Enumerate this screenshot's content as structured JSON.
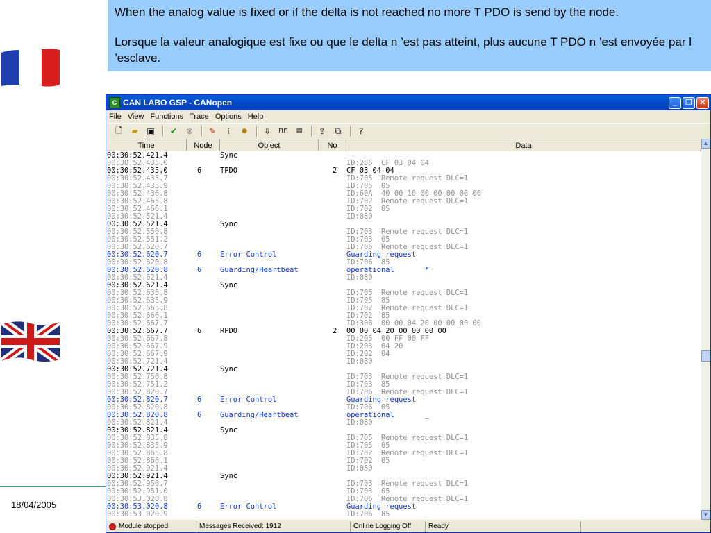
{
  "slide": {
    "caption_en": "When the analog value is fixed or if the delta is not reached no more T PDO is send by the node.",
    "caption_fr": "Lorsque la valeur analogique est fixe ou que le delta n ’est pas atteint, plus aucune T PDO n ’est envoyée par l ’esclave.",
    "date": "18/04/2005"
  },
  "window": {
    "title": "CAN LABO GSP - CANopen",
    "menu": [
      "File",
      "View",
      "Functions",
      "Trace",
      "Options",
      "Help"
    ],
    "columns": [
      "Time",
      "Node",
      "Object",
      "No",
      "Data"
    ]
  },
  "log": [
    {
      "time": "00:30:52.421.4",
      "node": "",
      "object": "Sync",
      "no": "",
      "data": "",
      "style": "black"
    },
    {
      "time": "00:30:52.435.0",
      "node": "",
      "object": "",
      "no": "",
      "data": "ID:286  CF 03 04 04",
      "style": "gray"
    },
    {
      "time": "00:30:52.435.0",
      "node": "6",
      "object": "TPDO",
      "no": "2",
      "data": "CF 03 04 04",
      "style": "black"
    },
    {
      "time": "00:30:52.435.7",
      "node": "",
      "object": "",
      "no": "",
      "data": "ID:705  Remote request DLC=1",
      "style": "gray"
    },
    {
      "time": "00:30:52.435.9",
      "node": "",
      "object": "",
      "no": "",
      "data": "ID:705  05",
      "style": "gray"
    },
    {
      "time": "00:30:52.436.8",
      "node": "",
      "object": "",
      "no": "",
      "data": "ID:60A  40 00 10 00 00 00 00 00",
      "style": "gray"
    },
    {
      "time": "00:30:52.465.8",
      "node": "",
      "object": "",
      "no": "",
      "data": "ID:702  Remote request DLC=1",
      "style": "gray"
    },
    {
      "time": "00:30:52.466.1",
      "node": "",
      "object": "",
      "no": "",
      "data": "ID:702  05",
      "style": "gray"
    },
    {
      "time": "00:30:52.521.4",
      "node": "",
      "object": "",
      "no": "",
      "data": "ID:080",
      "style": "gray"
    },
    {
      "time": "00:30:52.521.4",
      "node": "",
      "object": "Sync",
      "no": "",
      "data": "",
      "style": "black"
    },
    {
      "time": "00:30:52.550.8",
      "node": "",
      "object": "",
      "no": "",
      "data": "ID:703  Remote request DLC=1",
      "style": "gray"
    },
    {
      "time": "00:30:52.551.2",
      "node": "",
      "object": "",
      "no": "",
      "data": "ID:703  05",
      "style": "gray"
    },
    {
      "time": "00:30:52.620.7",
      "node": "",
      "object": "",
      "no": "",
      "data": "ID:706  Remote request DLC=1",
      "style": "gray"
    },
    {
      "time": "00:30:52.620.7",
      "node": "6",
      "object": "Error Control",
      "no": "",
      "data": "Guarding request",
      "style": "blue"
    },
    {
      "time": "00:30:52.620.8",
      "node": "",
      "object": "",
      "no": "",
      "data": "ID:706  85",
      "style": "gray"
    },
    {
      "time": "00:30:52.620.8",
      "node": "6",
      "object": "Guarding/Heartbeat",
      "no": "",
      "data": "operational       *",
      "style": "blue"
    },
    {
      "time": "00:30:52.621.4",
      "node": "",
      "object": "",
      "no": "",
      "data": "ID:080",
      "style": "gray"
    },
    {
      "time": "00:30:52.621.4",
      "node": "",
      "object": "Sync",
      "no": "",
      "data": "",
      "style": "black"
    },
    {
      "time": "00:30:52.635.8",
      "node": "",
      "object": "",
      "no": "",
      "data": "ID:705  Remote request DLC=1",
      "style": "gray"
    },
    {
      "time": "00:30:52.635.9",
      "node": "",
      "object": "",
      "no": "",
      "data": "ID:705  85",
      "style": "gray"
    },
    {
      "time": "00:30:52.665.8",
      "node": "",
      "object": "",
      "no": "",
      "data": "ID:702  Remote request DLC=1",
      "style": "gray"
    },
    {
      "time": "00:30:52.666.1",
      "node": "",
      "object": "",
      "no": "",
      "data": "ID:702  85",
      "style": "gray"
    },
    {
      "time": "00:30:52.667.7",
      "node": "",
      "object": "",
      "no": "",
      "data": "ID:306  00 00 04 20 00 00 00 00",
      "style": "gray"
    },
    {
      "time": "00:30:52.667.7",
      "node": "6",
      "object": "RPDO",
      "no": "2",
      "data": "00 00 04 20 00 00 00 00",
      "style": "black"
    },
    {
      "time": "00:30:52.667.8",
      "node": "",
      "object": "",
      "no": "",
      "data": "ID:205  00 FF 00 FF",
      "style": "gray"
    },
    {
      "time": "00:30:52.667.9",
      "node": "",
      "object": "",
      "no": "",
      "data": "ID:203  04 20",
      "style": "gray"
    },
    {
      "time": "00:30:52.667.9",
      "node": "",
      "object": "",
      "no": "",
      "data": "ID:202  04",
      "style": "gray"
    },
    {
      "time": "00:30:52.721.4",
      "node": "",
      "object": "",
      "no": "",
      "data": "ID:080",
      "style": "gray"
    },
    {
      "time": "00:30:52.721.4",
      "node": "",
      "object": "Sync",
      "no": "",
      "data": "",
      "style": "black"
    },
    {
      "time": "00:30:52.750.8",
      "node": "",
      "object": "",
      "no": "",
      "data": "ID:703  Remote request DLC=1",
      "style": "gray"
    },
    {
      "time": "00:30:52.751.2",
      "node": "",
      "object": "",
      "no": "",
      "data": "ID:703  85",
      "style": "gray"
    },
    {
      "time": "00:30:52.820.7",
      "node": "",
      "object": "",
      "no": "",
      "data": "ID:706  Remote request DLC=1",
      "style": "gray"
    },
    {
      "time": "00:30:52.820.7",
      "node": "6",
      "object": "Error Control",
      "no": "",
      "data": "Guarding request",
      "style": "blue"
    },
    {
      "time": "00:30:52.820.8",
      "node": "",
      "object": "",
      "no": "",
      "data": "ID:706  05",
      "style": "gray"
    },
    {
      "time": "00:30:52.820.8",
      "node": "6",
      "object": "Guarding/Heartbeat",
      "no": "",
      "data": "operational       _",
      "style": "blue"
    },
    {
      "time": "00:30:52.821.4",
      "node": "",
      "object": "",
      "no": "",
      "data": "ID:080",
      "style": "gray"
    },
    {
      "time": "00:30:52.821.4",
      "node": "",
      "object": "Sync",
      "no": "",
      "data": "",
      "style": "black"
    },
    {
      "time": "00:30:52.835.8",
      "node": "",
      "object": "",
      "no": "",
      "data": "ID:705  Remote request DLC=1",
      "style": "gray"
    },
    {
      "time": "00:30:52.835.9",
      "node": "",
      "object": "",
      "no": "",
      "data": "ID:705  05",
      "style": "gray"
    },
    {
      "time": "00:30:52.865.8",
      "node": "",
      "object": "",
      "no": "",
      "data": "ID:702  Remote request DLC=1",
      "style": "gray"
    },
    {
      "time": "00:30:52.866.1",
      "node": "",
      "object": "",
      "no": "",
      "data": "ID:702  05",
      "style": "gray"
    },
    {
      "time": "00:30:52.921.4",
      "node": "",
      "object": "",
      "no": "",
      "data": "ID:080",
      "style": "gray"
    },
    {
      "time": "00:30:52.921.4",
      "node": "",
      "object": "Sync",
      "no": "",
      "data": "",
      "style": "black"
    },
    {
      "time": "00:30:52.950.7",
      "node": "",
      "object": "",
      "no": "",
      "data": "ID:703  Remote request DLC=1",
      "style": "gray"
    },
    {
      "time": "00:30:52.951.0",
      "node": "",
      "object": "",
      "no": "",
      "data": "ID:703  05",
      "style": "gray"
    },
    {
      "time": "00:30:53.020.8",
      "node": "",
      "object": "",
      "no": "",
      "data": "ID:706  Remote request DLC=1",
      "style": "gray"
    },
    {
      "time": "00:30:53.020.8",
      "node": "6",
      "object": "Error Control",
      "no": "",
      "data": "Guarding request",
      "style": "blue"
    },
    {
      "time": "00:30:53.020.9",
      "node": "",
      "object": "",
      "no": "",
      "data": "ID:706  85",
      "style": "gray"
    }
  ],
  "status": {
    "module": "Module stopped",
    "messages": "Messages Received: 1912",
    "logging": "Online Logging Off",
    "ready": "Ready"
  },
  "colors": {
    "caption_bg": "#99ccff",
    "titlebar": "#0348c8",
    "log_gray": "#909090",
    "log_blue": "#0b36d8"
  },
  "icons": {
    "toolbar": [
      "new-file-icon",
      "open-folder-icon",
      "save-icon",
      "start-icon",
      "stop-icon",
      "eraser-icon",
      "filter-icon",
      "settings-icon",
      "download-icon",
      "signal-icon",
      "display-icon",
      "export-icon",
      "window-icon",
      "help-icon"
    ]
  }
}
